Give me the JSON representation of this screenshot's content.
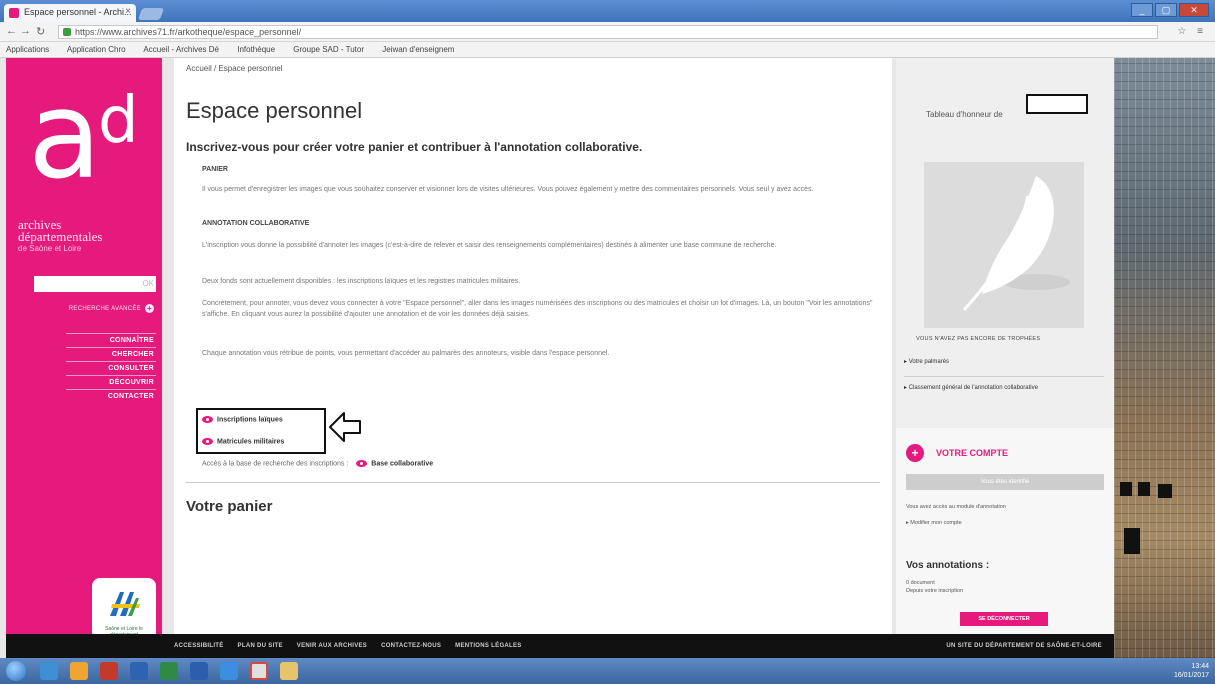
{
  "browser": {
    "tab_title": "Espace personnel - Archi...",
    "tab_close": "×",
    "url": "https://www.archives71.fr/arkotheque/espace_personnel/",
    "bookmarks": [
      "Applications",
      "Application Chro",
      "Accueil - Archives Dé",
      "Infothèque",
      "Groupe SAD - Tutor",
      "Jeiwan d'enseignem"
    ]
  },
  "sidebar": {
    "logo_a": "a",
    "logo_d": "d",
    "brand_line1": "archives",
    "brand_line2": "départementales",
    "brand_line3": "de Saône et Loire",
    "search_ok": "OK",
    "advanced_search": "RECHERCHE AVANCÉE",
    "nav": [
      "CONNAÎTRE",
      "CHERCHER",
      "CONSULTER",
      "DÉCOUVRIR",
      "CONTACTER"
    ],
    "dept_logo_text": "Saône et Loire le département"
  },
  "main": {
    "breadcrumb": "Accueil / Espace personnel",
    "title": "Espace personnel",
    "intro": "Inscrivez-vous pour créer votre panier et contribuer à l'annotation collaborative.",
    "section_panier": "PANIER",
    "panier_text": "Il vous permet d'enregistrer les images que vous souhaitez conserver et visionner lors de visites ultérieures. Vous pouvez également y mettre des commentaires personnels. Vous seul y avez accès.",
    "section_annotation": "ANNOTATION COLLABORATIVE",
    "annotation_text": "L'inscription vous donne la possibilité d'annoter les images (c'est-à-dire de relever et saisir des renseignements complémentaires) destinés à alimenter une base commune de recherche.",
    "fonds_text": "Deux fonds sont actuellement disponibles : les inscriptions laïques et les registres matricules militaires.",
    "concretement_text": "Concrètement, pour annoter, vous devez vous connecter à votre \"Espace personnel\", aller dans les images numérisées des inscriptions ou des matricules et choisir un lot d'images. Là, un bouton \"Voir les annotations\" s'affiche. En cliquant vous aurez la possibilité d'ajouter une annotation et de voir les données déjà saisies.",
    "points_text": "Chaque annotation vous rétribue de points, vous permettant d'accéder au palmarès des annoteurs, visible dans l'espace personnel.",
    "link_laiques": "Inscriptions laïques",
    "link_militaires": "Matricules militaires",
    "access_label": "Accès à la base de recherche des inscriptions :",
    "access_link": "Base collaborative",
    "panier_title": "Votre panier"
  },
  "right": {
    "honor_label": "Tableau d'honneur de",
    "feather_caption": "VOUS N'AVEZ PAS ENCORE DE TROPHÉES",
    "link_palmares": "Votre palmarès",
    "link_classement": "Classement général de l'annotation collaborative",
    "account_title": "VOTRE COMPTE",
    "account_button": "Vous êtes identifié",
    "account_access": "Vous avez accès au module d'annotation",
    "link_modify": "Modifier mon compte",
    "annotations_title": "Vos annotations :",
    "annotations_count": "0 document",
    "annotations_sub": "Depuis votre inscription",
    "logout": "SE DÉCONNECTER"
  },
  "footer": {
    "links": [
      "ACCESSIBILITÉ",
      "PLAN DU SITE",
      "VENIR AUX ARCHIVES",
      "CONTACTEZ-NOUS",
      "MENTIONS LÉGALES"
    ],
    "right": "UN SITE DU DÉPARTEMENT DE SAÔNE-ET-LOIRE"
  },
  "taskbar": {
    "time": "13:44",
    "date": "16/01/2017"
  },
  "colors": {
    "brand_pink": "#e6197d",
    "footer_black": "#111111"
  }
}
